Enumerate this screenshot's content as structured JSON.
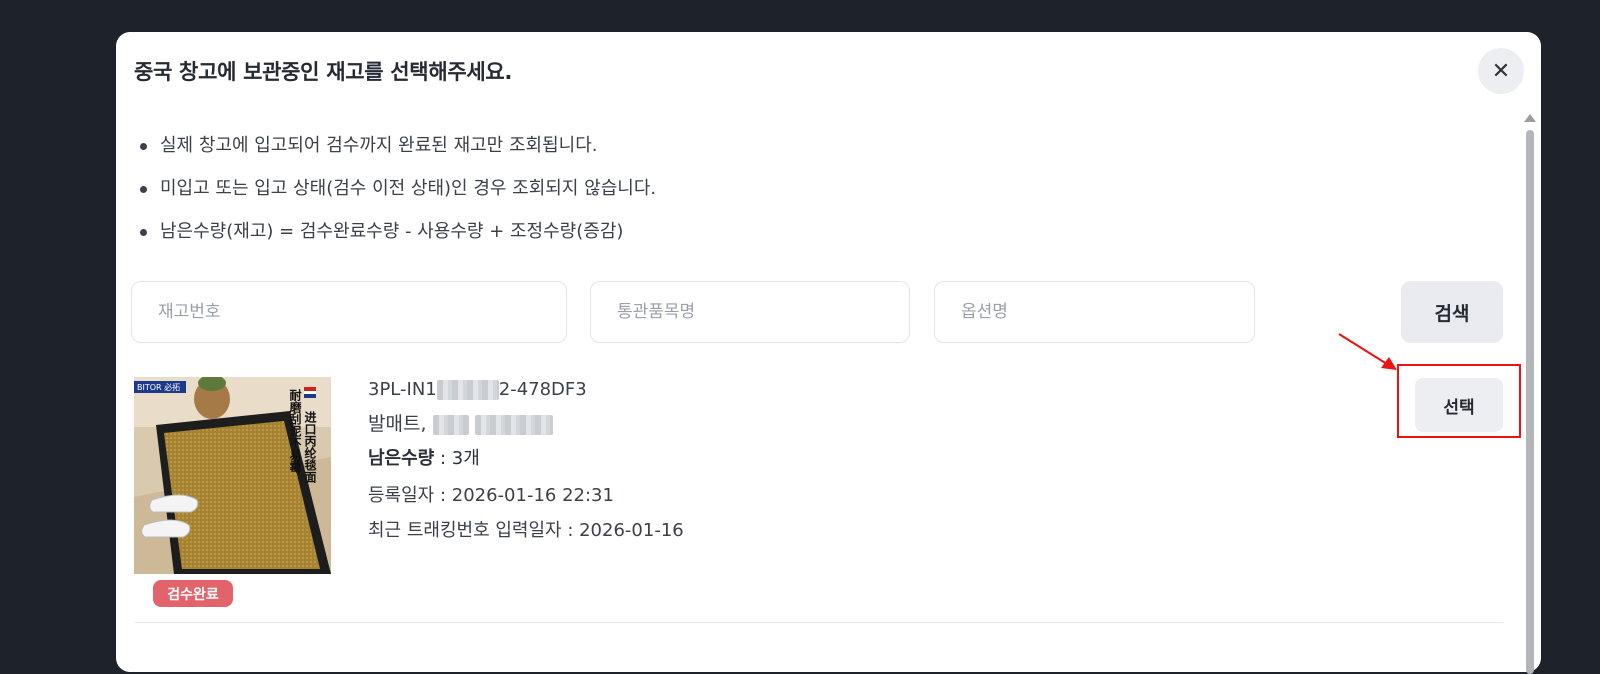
{
  "modal": {
    "title": "중국 창고에 보관중인 재고를 선택해주세요.",
    "close_icon": "close-icon",
    "notes": [
      "실제 창고에 입고되어 검수까지 완료된 재고만 조회됩니다.",
      "미입고 또는 입고 상태(검수 이전 상태)인 경우 조회되지 않습니다.",
      "남은수량(재고) = 검수완료수량 - 사용수량 + 조정수량(증감)"
    ],
    "search": {
      "stock_no_placeholder": "재고번호",
      "customs_name_placeholder": "통관품목명",
      "option_name_placeholder": "옵션명",
      "button_label": "검색"
    }
  },
  "item": {
    "image_brand": "BITOR 必拓",
    "image_text_right": "进口丙纶毯面",
    "image_text_left": "耐磨刮泥不易霉",
    "badge": "검수완료",
    "stock_no_prefix": "3PL-IN1",
    "stock_no_suffix": "2-478DF3",
    "name_prefix": "발매트, ",
    "remain_label": "남은수량",
    "remain_value": " : 3개",
    "registered": "등록일자 : 2026-01-16 22:31",
    "tracking": "최근 트래킹번호 입력일자 : 2026-01-16",
    "select_label": "선택"
  },
  "colors": {
    "backdrop": "#1e222b",
    "badge": "#e2636b",
    "highlight": "#e11111"
  }
}
